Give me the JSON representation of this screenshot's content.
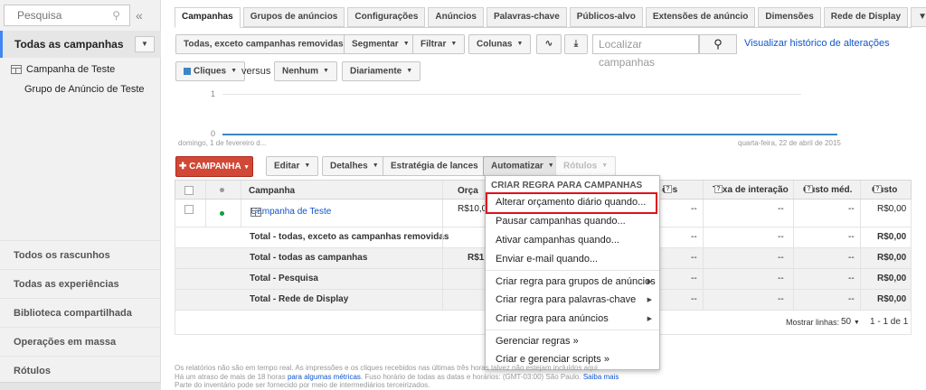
{
  "sidebar": {
    "search_placeholder": "Pesquisa",
    "collapse": "«",
    "all_campaigns": "Todas as campanhas",
    "campaign": "Campanha de Teste",
    "ad_group": "Grupo de Anúncio de Teste",
    "bottom_items": [
      "Todos os rascunhos",
      "Todas as experiências",
      "Biblioteca compartilhada",
      "Operações em massa",
      "Rótulos"
    ]
  },
  "tabs": [
    "Campanhas",
    "Grupos de anúncios",
    "Configurações",
    "Anúncios",
    "Palavras-chave",
    "Públicos-alvo",
    "Extensões de anúncio",
    "Dimensões",
    "Rede de Display"
  ],
  "toolbar": {
    "filter_status": "Todas, exceto campanhas removidas",
    "segment": "Segmentar",
    "filter": "Filtrar",
    "columns": "Colunas",
    "search_placeholder": "Localizar campanhas",
    "history_link": "Visualizar histórico de alterações"
  },
  "chart_controls": {
    "metric": "Cliques",
    "versus": "versus",
    "compare": "Nenhum",
    "period": "Diariamente"
  },
  "chart_data": {
    "type": "line",
    "series": [
      {
        "name": "Cliques",
        "values": [
          0,
          0
        ]
      }
    ],
    "x": [
      "domingo, 1 de fevereiro d...",
      "quarta-feira, 22 de abril de 2015"
    ],
    "y_ticks": [
      "1",
      "0"
    ],
    "ylim": [
      0,
      1
    ]
  },
  "actions": {
    "new_campaign": "CAMPANHA",
    "edit": "Editar",
    "details": "Detalhes",
    "bid_strategy": "Estratégia de lances",
    "automate": "Automatizar",
    "labels": "Rótulos"
  },
  "table": {
    "headers": {
      "campaign": "Campanha",
      "budget": "Orça",
      "impressions": "ões",
      "interaction_rate": "Taxa de interação",
      "avg_cost": "Custo méd.",
      "cost": "Custo"
    },
    "rows": [
      {
        "campaign": "Campanha de Teste",
        "budget": "R$10,0",
        "impr": "--",
        "rate": "--",
        "avg": "--",
        "cost": "R$0,00"
      },
      {
        "campaign": "Total - todas, exceto as campanhas removidas",
        "budget": "",
        "impr": "--",
        "rate": "--",
        "avg": "--",
        "cost": "R$0,00"
      },
      {
        "campaign": "Total - todas as campanhas",
        "budget": "R$1",
        "impr": "--",
        "rate": "--",
        "avg": "--",
        "cost": "R$0,00"
      },
      {
        "campaign": "Total - Pesquisa",
        "budget": "",
        "impr": "--",
        "rate": "--",
        "avg": "--",
        "cost": "R$0,00"
      },
      {
        "campaign": "Total - Rede de Display",
        "budget": "",
        "impr": "--",
        "rate": "--",
        "avg": "--",
        "cost": "R$0,00"
      }
    ],
    "show_rows_label": "Mostrar linhas:",
    "show_rows_value": "50",
    "pagination": "1 - 1 de 1"
  },
  "dropdown": {
    "header": "CRIAR REGRA PARA CAMPANHAS",
    "group1": [
      "Alterar orçamento diário quando...",
      "Pausar campanhas quando...",
      "Ativar campanhas quando...",
      "Enviar e-mail quando..."
    ],
    "group2": [
      "Criar regra para grupos de anúncios",
      "Criar regra para palavras-chave",
      "Criar regra para anúncios"
    ],
    "group3": [
      "Gerenciar regras »",
      "Criar e gerenciar scripts »"
    ]
  },
  "footnote": {
    "line1": "Os relatórios não são em tempo real. As impressões e os cliques recebidos nas últimas três horas talvez não estejam incluídos aqui.",
    "line2a": "Há um atraso de mais de 18 horas",
    "line2_link": "para algumas métricas",
    "line2b": ". Fuso horário de todas as datas e horários: (GMT-03:00) São Paulo.",
    "line2_link2": "Saiba mais",
    "line3": "Parte do inventário pode ser fornecido por meio de intermediários terceirizados."
  }
}
